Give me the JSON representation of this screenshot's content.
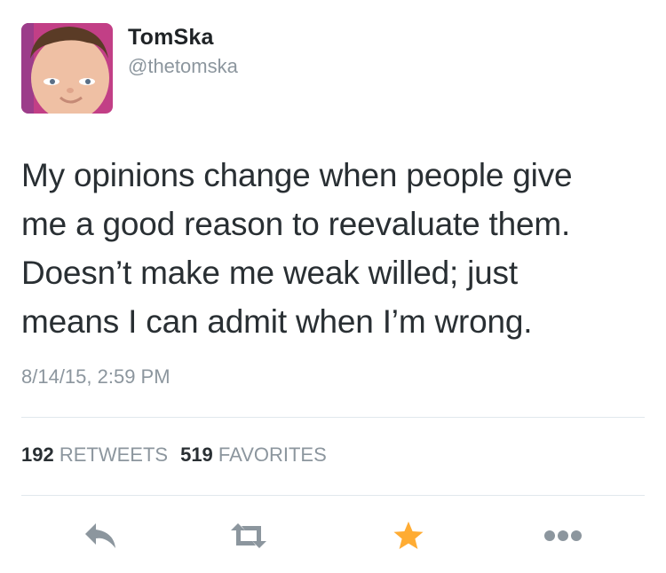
{
  "author": {
    "display_name": "TomSka",
    "handle": "@thetomska"
  },
  "tweet": {
    "lines": [
      "My opinions change when people give",
      "me a good reason to reevaluate them.",
      "Doesn’t make me weak willed; just",
      "means I can admit when I’m wrong."
    ],
    "timestamp": "8/14/15, 2:59 PM"
  },
  "stats": {
    "retweets_count": "192",
    "retweets_label": "RETWEETS",
    "favorites_count": "519",
    "favorites_label": "FAVORITES"
  },
  "actions": {
    "icons": [
      "reply-icon",
      "retweet-icon",
      "favorite-star-icon",
      "more-icon"
    ],
    "favorited": true
  },
  "colors": {
    "text": "#292f33",
    "secondary": "#8c969e",
    "divider": "#e1e8ed",
    "favorite": "#ffac33"
  }
}
